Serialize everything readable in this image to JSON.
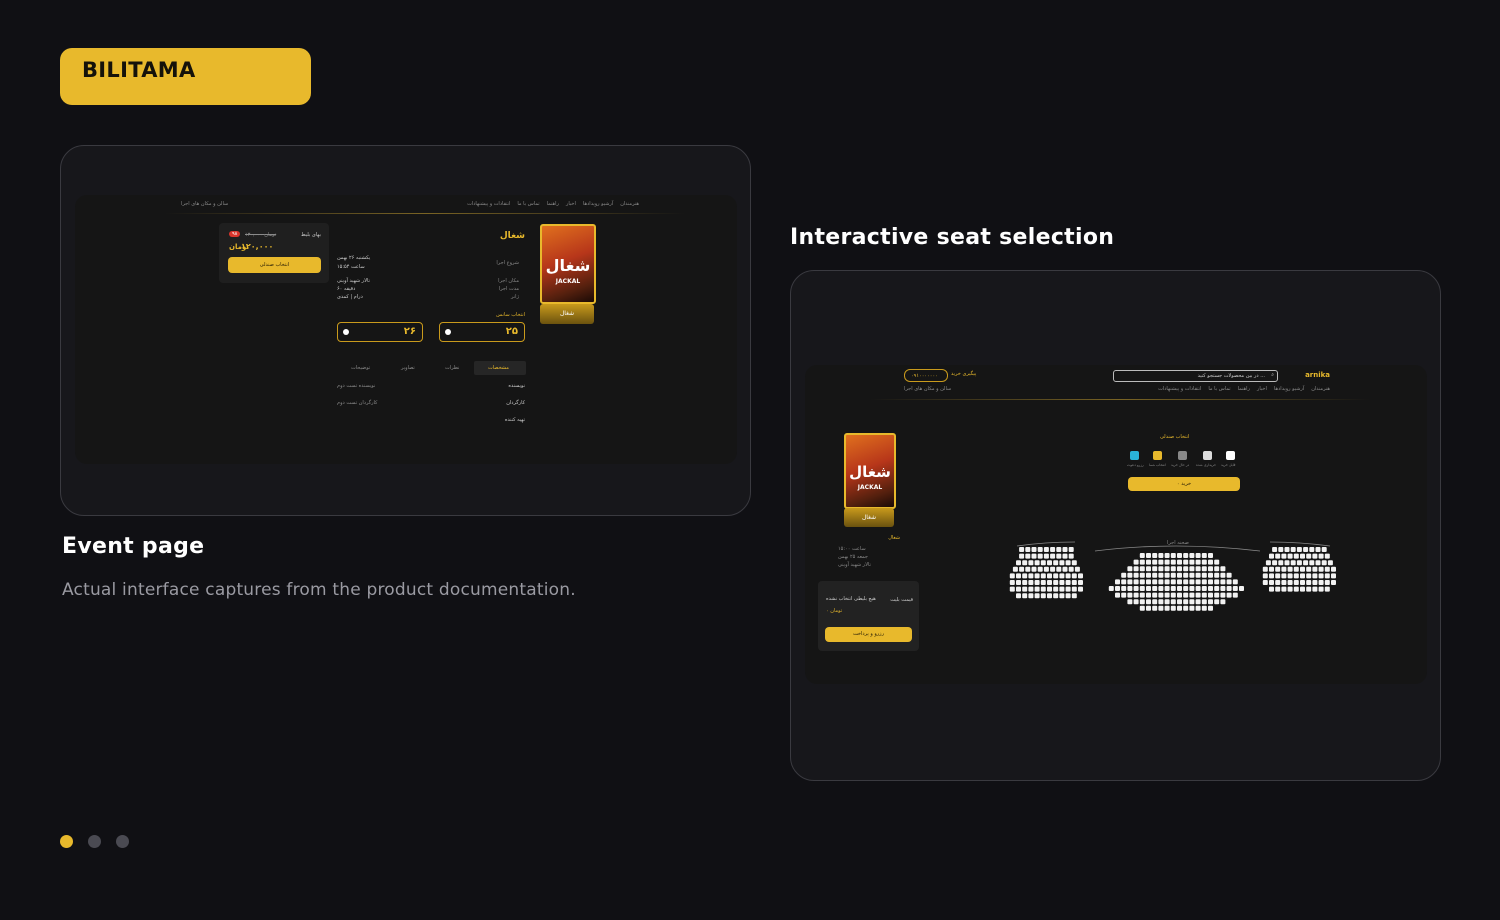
{
  "brand": {
    "name": "BILITAMA"
  },
  "captures": {
    "event": {
      "title": "Event page",
      "nav": {
        "items": [
          "هنرمندان",
          "آرشیو رویدادها",
          "اخبار",
          "راهنما",
          "تماس با ما",
          "انتقادات و پیشنهادات"
        ],
        "venues": "سالن و مکان های اجرا"
      },
      "event_title": "شغال",
      "details": {
        "start_label": "شروع اجرا",
        "date": "یکشنبه ۲۶ بهمن",
        "time": "ساعت ۱۵:۵۴",
        "venue_label": "مکان اجرا",
        "venue": "تالار شهید آوینی",
        "duration_label": "مدت اجرا",
        "duration": "دقیقه ۶۰",
        "genre_label": "ژانر",
        "genre": "درام | کمدی"
      },
      "select_session": "انتخاب سانس",
      "sessions": [
        "۲۵",
        "۲۶"
      ],
      "ticket": {
        "label": "بهای بلیط",
        "old_price": "۱۳۰,۰۰۰ تومان",
        "discount": "۹۸",
        "price": "۱۲۰,۰۰۰",
        "currency": "تومان",
        "button": "انتخاب صندلی"
      },
      "tabs": [
        "مشخصات",
        "نظرات",
        "تصاویر",
        "توضیحات"
      ],
      "specs": [
        {
          "key": "نویسنده",
          "value": "نویسنده تست دوم"
        },
        {
          "key": "کارگردان",
          "value": "کارگردان تست دوم"
        },
        {
          "key": "تهیه کننده",
          "value": ""
        }
      ],
      "poster": {
        "title": "شغال",
        "subtitle": "JACKAL",
        "button": "شغال"
      }
    },
    "seats": {
      "title": "Interactive seat selection",
      "logo": "arnika",
      "search_placeholder": "در بین محصولات جستجو کنید ...",
      "phone": "۰۹۱۰۰۰۰۰۰۰",
      "track": "پیگیری خرید",
      "nav": {
        "items": [
          "هنرمندان",
          "آرشیو رویدادها",
          "اخبار",
          "راهنما",
          "تماس با ما",
          "انتقادات و پیشنهادات"
        ],
        "venues": "سالن و مکان های اجرا"
      },
      "select_seat": "انتخاب صندلی",
      "legend": [
        "قابل خرید",
        "خریداری شده",
        "در حال خرید",
        "انتخاب شما",
        "رزرو دعوت"
      ],
      "buy_button": "خرید ۰",
      "stage": "صحنه اجرا",
      "event_name": "شغال",
      "info": [
        "ساعت ۱۵:۰۰",
        "جمعه ۲۵ بهمن",
        "تالار شهید آوینی"
      ],
      "summary": {
        "price_label": "قیمت بلیت",
        "selected": "هیچ بلیطی انتخاب نشده",
        "total": "۰ تومان",
        "button": "رزرو و پرداخت"
      },
      "poster": {
        "title": "شغال",
        "subtitle": "JACKAL",
        "button": "شغال"
      }
    }
  },
  "caption": {
    "description": "Actual interface captures from the product documentation."
  },
  "pagination": {
    "count": 3,
    "active": 0
  },
  "colors": {
    "accent": "#e8b92c",
    "background": "#101014",
    "card": "#17171b"
  }
}
